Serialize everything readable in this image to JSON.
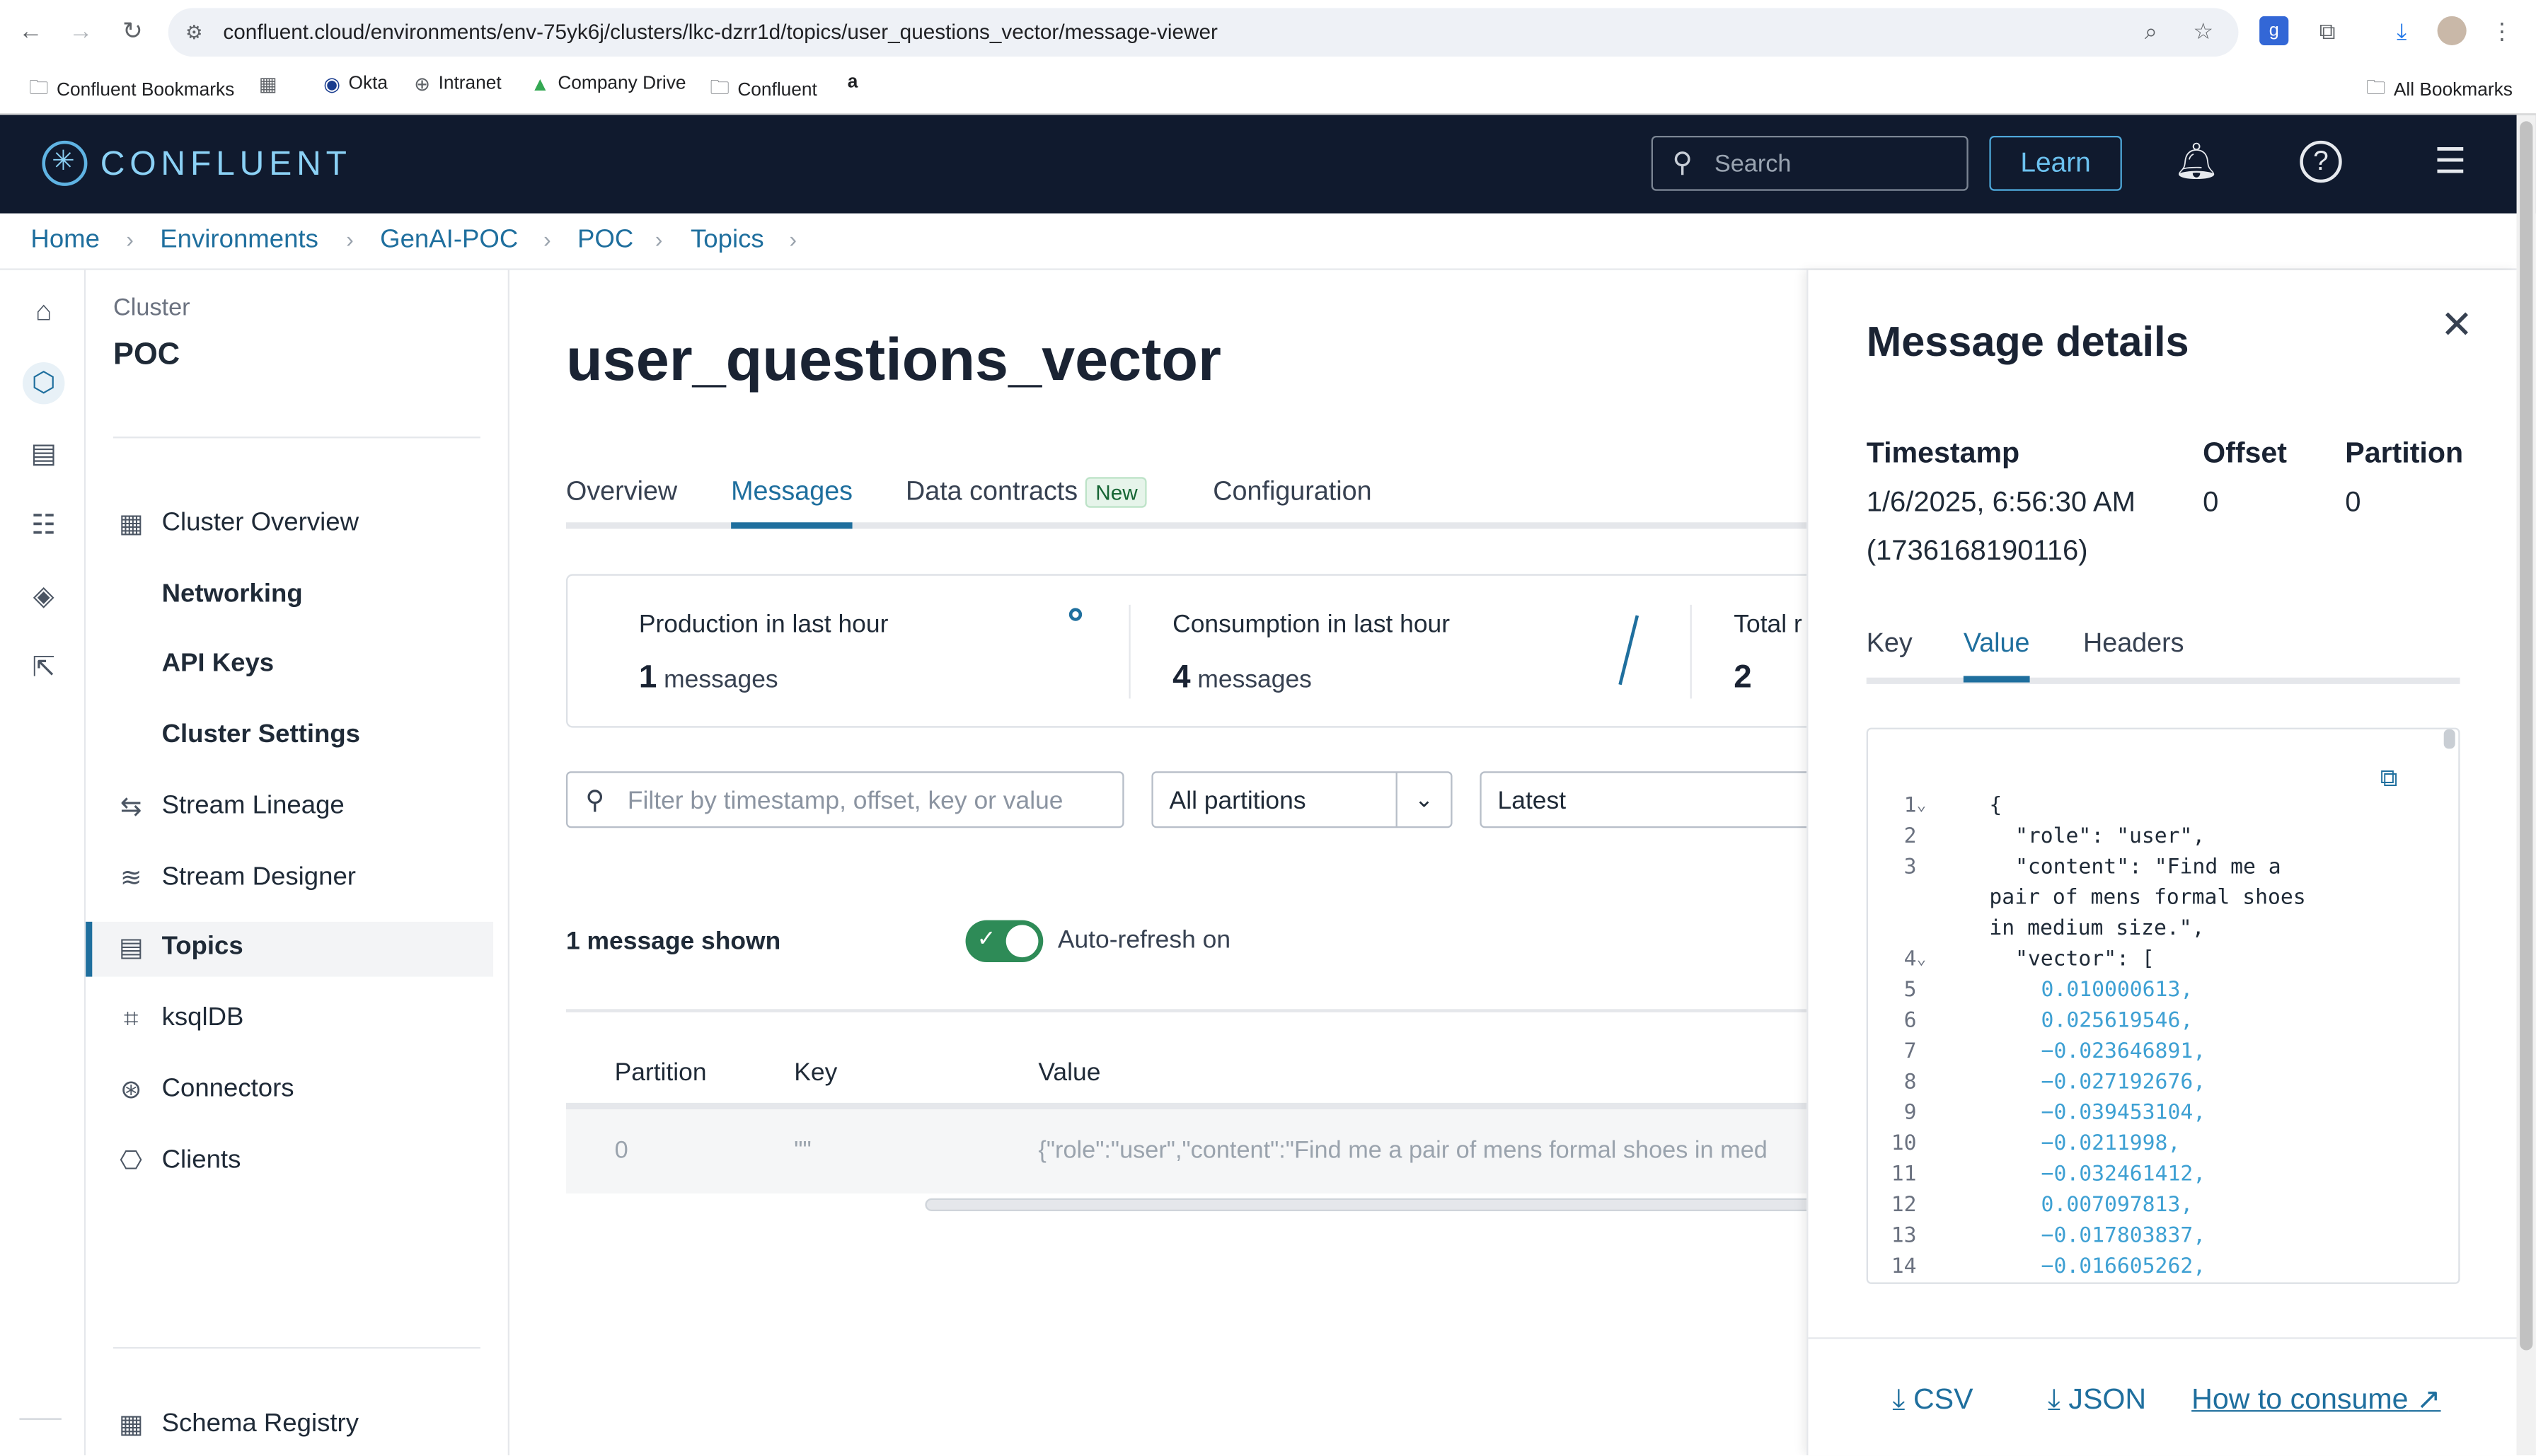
{
  "browser": {
    "url": "confluent.cloud/environments/env-75yk6j/clusters/lkc-dzrr1d/topics/user_questions_vector/message-viewer",
    "bookmarks": [
      "Confluent Bookmarks",
      "Okta",
      "Intranet",
      "Company Drive",
      "Confluent"
    ],
    "all_bookmarks": "All Bookmarks"
  },
  "header": {
    "brand": "CONFLUENT",
    "search_placeholder": "Search",
    "learn_label": "Learn"
  },
  "breadcrumb": [
    "Home",
    "Environments",
    "GenAI-POC",
    "POC",
    "Topics"
  ],
  "sidebar": {
    "cluster_label": "Cluster",
    "cluster_name": "POC",
    "items": [
      {
        "label": "Cluster Overview",
        "icon": "dashboard-icon"
      },
      {
        "label": "Networking",
        "icon": ""
      },
      {
        "label": "API Keys",
        "icon": ""
      },
      {
        "label": "Cluster Settings",
        "icon": ""
      },
      {
        "label": "Stream Lineage",
        "icon": "lineage-icon"
      },
      {
        "label": "Stream Designer",
        "icon": "designer-icon"
      },
      {
        "label": "Topics",
        "icon": "topics-icon"
      },
      {
        "label": "ksqlDB",
        "icon": "ksqldb-icon"
      },
      {
        "label": "Connectors",
        "icon": "connectors-icon"
      },
      {
        "label": "Clients",
        "icon": "clients-icon"
      }
    ],
    "bottom_item": "Schema Registry"
  },
  "main": {
    "title": "user_questions_vector",
    "tabs": [
      "Overview",
      "Messages",
      "Data contracts",
      "Configuration"
    ],
    "new_badge": "New",
    "stats": {
      "production_label": "Production in last hour",
      "production_count": "1",
      "production_unit": "messages",
      "consumption_label": "Consumption in last hour",
      "consumption_count": "4",
      "consumption_unit": "messages",
      "total_label": "Total r",
      "total_value": "2"
    },
    "filter_placeholder": "Filter by timestamp, offset, key or value",
    "partitions_select": "All partitions",
    "offset_select": "Latest",
    "shown_text": "1 message shown",
    "autorefresh_label": "Auto-refresh on",
    "autorefresh_on": true,
    "table": {
      "headers": [
        "Partition",
        "Key",
        "Value"
      ],
      "rows": [
        {
          "partition": "0",
          "key": "\"\"",
          "value": "{\"role\":\"user\",\"content\":\"Find me a pair of mens formal shoes in med"
        }
      ]
    }
  },
  "drawer": {
    "title": "Message details",
    "timestamp_label": "Timestamp",
    "timestamp_value": "1/6/2025, 6:56:30 AM",
    "timestamp_epoch": "(1736168190116)",
    "offset_label": "Offset",
    "offset_value": "0",
    "partition_label": "Partition",
    "partition_value": "0",
    "tabs": [
      "Key",
      "Value",
      "Headers"
    ],
    "code_lines": [
      {
        "n": "1",
        "fold": true,
        "indent": 0,
        "text": "{",
        "kind": "k"
      },
      {
        "n": "2",
        "fold": false,
        "indent": 1,
        "text": "\"role\": \"user\",",
        "kind": "k"
      },
      {
        "n": "3",
        "fold": false,
        "indent": 1,
        "text": "\"content\": \"Find me a",
        "kind": "k"
      },
      {
        "n": "",
        "fold": false,
        "indent": 0,
        "text": "pair of mens formal shoes",
        "kind": "str"
      },
      {
        "n": "",
        "fold": false,
        "indent": 0,
        "text": "in medium size.\",",
        "kind": "str"
      },
      {
        "n": "4",
        "fold": true,
        "indent": 1,
        "text": "\"vector\": [",
        "kind": "k"
      },
      {
        "n": "5",
        "fold": false,
        "indent": 2,
        "text": "0.010000613,",
        "kind": "num"
      },
      {
        "n": "6",
        "fold": false,
        "indent": 2,
        "text": "0.025619546,",
        "kind": "num"
      },
      {
        "n": "7",
        "fold": false,
        "indent": 2,
        "text": "−0.023646891,",
        "kind": "num"
      },
      {
        "n": "8",
        "fold": false,
        "indent": 2,
        "text": "−0.027192676,",
        "kind": "num"
      },
      {
        "n": "9",
        "fold": false,
        "indent": 2,
        "text": "−0.039453104,",
        "kind": "num"
      },
      {
        "n": "10",
        "fold": false,
        "indent": 2,
        "text": "−0.0211998,",
        "kind": "num"
      },
      {
        "n": "11",
        "fold": false,
        "indent": 2,
        "text": "−0.032461412,",
        "kind": "num"
      },
      {
        "n": "12",
        "fold": false,
        "indent": 2,
        "text": "0.007097813,",
        "kind": "num"
      },
      {
        "n": "13",
        "fold": false,
        "indent": 2,
        "text": "−0.017803837,",
        "kind": "num"
      },
      {
        "n": "14",
        "fold": false,
        "indent": 2,
        "text": "−0.016605262,",
        "kind": "num"
      }
    ],
    "csv_label": "CSV",
    "json_label": "JSON",
    "how_to_consume": "How to consume"
  }
}
